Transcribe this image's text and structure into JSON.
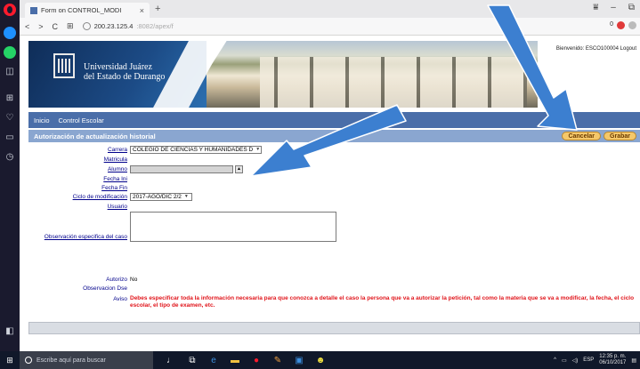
{
  "browser": {
    "tab_title": "Form on CONTROL_MODI",
    "tab_close": "×",
    "new_tab": "+",
    "url": "200.23.125.4",
    "url_dim": ":8082/apex/f",
    "back": "<",
    "forward": ">",
    "reload": "C",
    "grid": "⊞",
    "win_min": "–",
    "win_restore": "⧉"
  },
  "page": {
    "university_line1": "Universidad Juárez",
    "university_line2": "del Estado de Durango",
    "welcome": "Bienvenido: ESCO100004",
    "logout": "Logout",
    "nav": {
      "inicio": "Inicio",
      "control_escolar": "Control Escolar"
    },
    "form_title": "Autorización de actualización historial",
    "cancel_label": "Cancelar",
    "save_label": "Grabar"
  },
  "form": {
    "carrera_label": "Carrera",
    "carrera_value": "COLEGIO DE CIENCIAS Y HUMANIDADES D",
    "matricula_label": "Matricula",
    "alumno_label": "Alumno",
    "fecha_ini_label": "Fecha Ini",
    "fecha_fin_label": "Fecha Fin",
    "ciclo_label": "Ciclo de modificación",
    "ciclo_value": "2017-AGO/DIC 2/2",
    "usuario_label": "Usuario",
    "observacion_label": "Observación especifica del caso",
    "autorizo_label": "Autorizo",
    "autorizo_value": "No",
    "observacion_dse_label": "Observacion Dse",
    "aviso_label": "Aviso",
    "aviso_text": "Debes especificar toda la información necesaria para que conozca a detalle el caso la persona que va a autorizar la petición, tal como la materia que se va a modificar, la fecha, el ciclo escolar, el tipo de examen, etc."
  },
  "taskbar": {
    "search_placeholder": "Escribe aquí para buscar",
    "lang": "ESP",
    "time": "12:35 p. m.",
    "date": "06/10/2017"
  },
  "colors": {
    "nav_blue": "#4a6ea9",
    "header_blue": "#8aa6d0",
    "arrow_blue": "#3c7fd0",
    "aviso_red": "#e0141a",
    "label_blue": "#00008b"
  },
  "icons": [
    "opera-icon",
    "messenger-icon",
    "whatsapp-icon",
    "camera-icon",
    "grid-icon",
    "heart-icon",
    "window-icon",
    "clock-icon",
    "windows-icon"
  ]
}
